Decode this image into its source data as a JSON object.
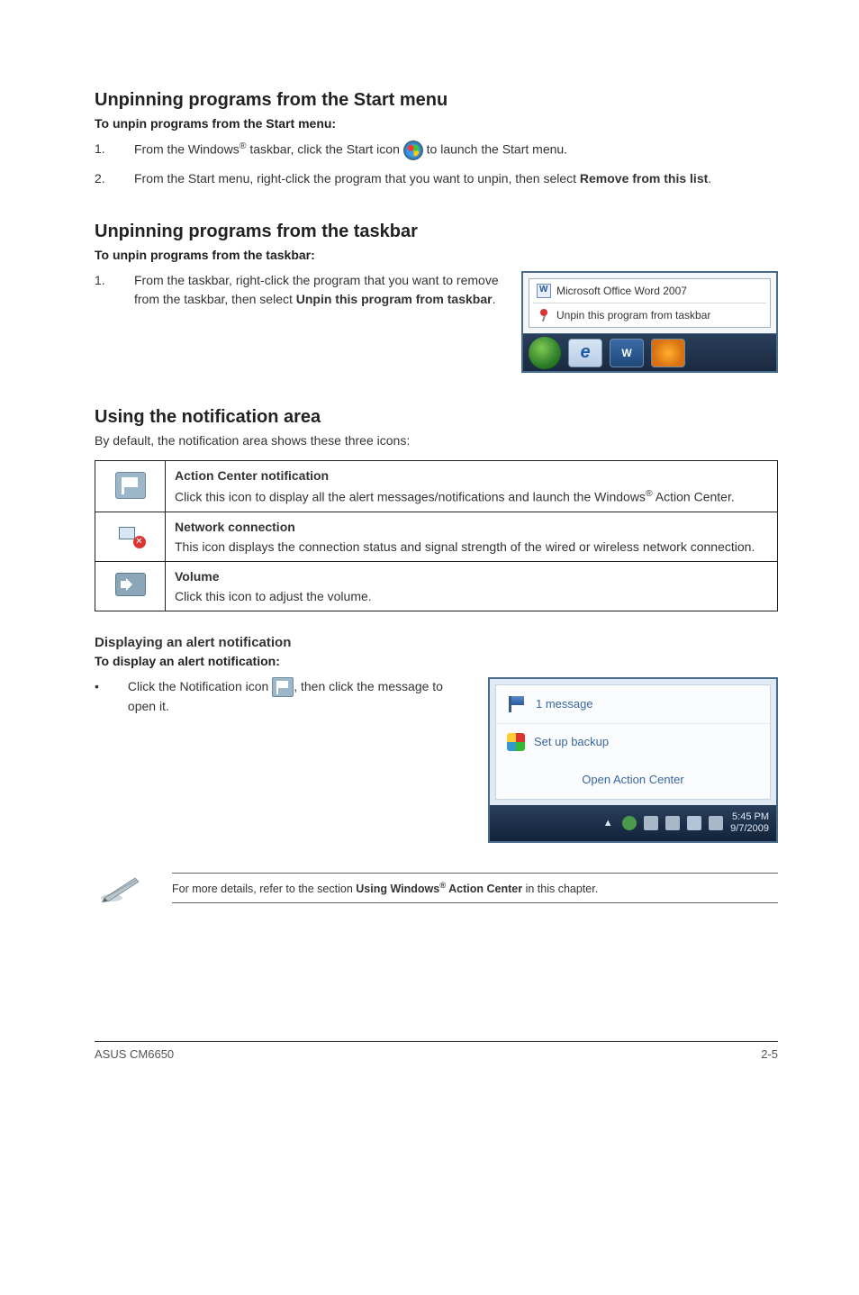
{
  "section1": {
    "heading": "Unpinning programs from the Start menu",
    "subhead": "To unpin programs from the Start menu:",
    "step1_pre": "From the Windows",
    "step1_sup": "®",
    "step1_mid": " taskbar, click the Start icon ",
    "step1_post": " to launch the Start menu.",
    "step2_pre": "From the Start menu, right-click the program that you want to unpin, then select ",
    "step2_bold": "Remove from this list",
    "step2_post": "."
  },
  "section2": {
    "heading": "Unpinning programs from the taskbar",
    "subhead": "To unpin programs from the taskbar:",
    "step1_pre": "From the taskbar, right-click the program that you want to remove from the taskbar, then select ",
    "step1_bold": "Unpin this program from taskbar",
    "step1_post": "."
  },
  "ctx": {
    "item1": "Microsoft Office Word 2007",
    "item2": "Unpin this program from taskbar",
    "word_label": "W"
  },
  "section3": {
    "heading": "Using the notification area",
    "intro": "By default, the notification area shows these three icons:"
  },
  "table": {
    "r1_title": "Action Center notification",
    "r1_body_pre": "Click this icon to display all the alert messages/notifications and launch the Windows",
    "r1_body_sup": "®",
    "r1_body_post": " Action Center.",
    "r2_title": "Network connection",
    "r2_body": "This icon displays the connection status and signal strength of the wired or wireless network connection.",
    "r3_title": "Volume",
    "r3_body": "Click this icon to adjust the volume."
  },
  "section4": {
    "heading": "Displaying an alert notification",
    "subhead": "To display an alert notification:",
    "bullet_pre": "Click the Notification icon ",
    "bullet_post": ", then click the message to open it."
  },
  "ac": {
    "messages": "1 message",
    "backup": "Set up backup",
    "open": "Open Action Center",
    "time": "5:45 PM",
    "date": "9/7/2009"
  },
  "note": {
    "pre": "For more details, refer to the section ",
    "bold_pre": "Using Windows",
    "bold_sup": "®",
    "bold_post": " Action Center",
    "post": " in this chapter."
  },
  "footer": {
    "left": "ASUS CM6650",
    "right": "2-5"
  },
  "nums": {
    "n1": "1.",
    "n2": "2."
  },
  "bullet": "•"
}
